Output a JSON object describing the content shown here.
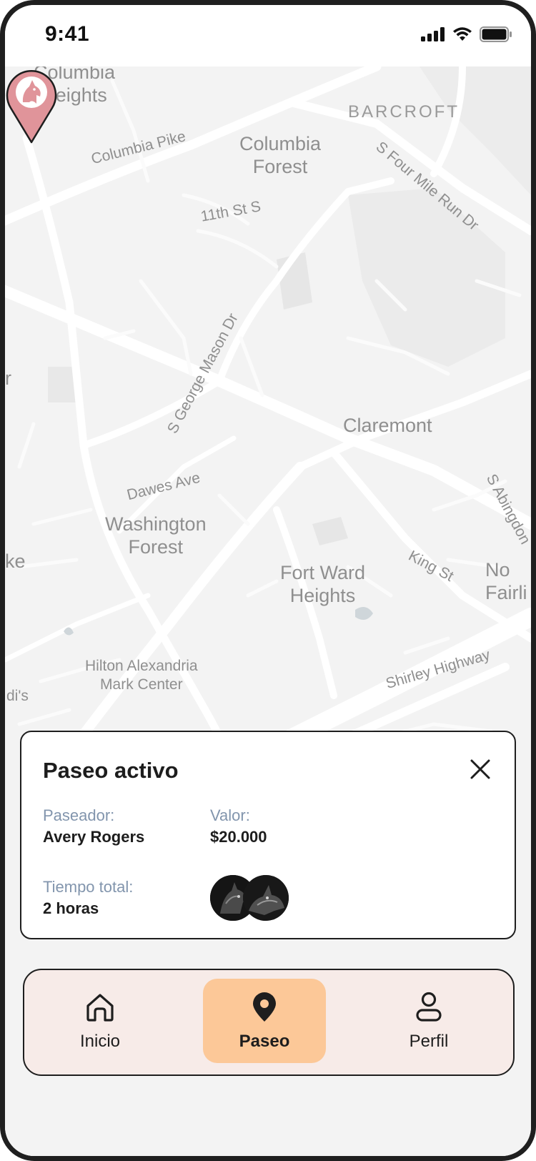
{
  "status_bar": {
    "time": "9:41",
    "icons": [
      "signal-icon",
      "wifi-icon",
      "battery-icon"
    ]
  },
  "map": {
    "labels": {
      "columbia_heights": "Columbia\nHeights",
      "barcroft": "BARCROFT",
      "columbia_pike": "Columbia Pike",
      "columbia_forest": "Columbia\nForest",
      "four_mile_run": "S Four Mile Run Dr",
      "eleventh_st": "11th St S",
      "george_mason": "S George Mason Dr",
      "claremont": "Claremont",
      "dawes_ave": "Dawes Ave",
      "abingdon": "S Abingdon",
      "washington_forest": "Washington\nForest",
      "king_st": "King St",
      "north_fairlington": "No\nFairli",
      "fort_ward": "Fort Ward\nHeights",
      "hilton": "Hilton Alexandria\nMark Center",
      "shirley_highway": "Shirley Highway",
      "edge_r": "r",
      "edge_ke": "ke",
      "edge_dis": "di's"
    },
    "pin_icon": "dog-location-pin-icon",
    "pin_color": "#e0949a"
  },
  "active_walk": {
    "title": "Paseo activo",
    "close_icon": "close-icon",
    "walker_label": "Paseador:",
    "walker_value": "Avery Rogers",
    "price_label": "Valor:",
    "price_value": "$20.000",
    "time_label": "Tiempo total:",
    "time_value": "2 horas",
    "pets": [
      "dog-photo-1",
      "dog-photo-2"
    ]
  },
  "tabbar": {
    "tabs": [
      {
        "label": "Inicio",
        "icon": "home-icon",
        "active": false
      },
      {
        "label": "Paseo",
        "icon": "location-pin-icon",
        "active": true
      },
      {
        "label": "Perfil",
        "icon": "user-icon",
        "active": false
      }
    ],
    "active_color": "#fcc898",
    "background": "#f7ebe8"
  }
}
